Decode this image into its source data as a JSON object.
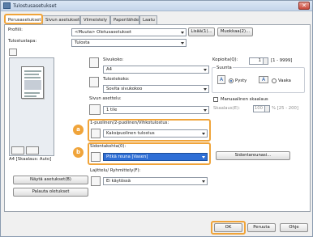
{
  "window": {
    "title": "Tulostusasetukset",
    "close_label": "✕"
  },
  "tabs": [
    "Perusasetukset",
    "Sivun asetukset",
    "Viimeistely",
    "Paperilähde",
    "Laatu"
  ],
  "profile": {
    "label": "Profiili:",
    "value": "<Muuta> Oletusasetukset",
    "add_button": "Lisää(1)...",
    "edit_button": "Muokkaa(2)..."
  },
  "output_method": {
    "label": "Tulostustapa:",
    "value": "Tulosta"
  },
  "preview": {
    "status": "A4 [Skaalaus: Auto]"
  },
  "page_size": {
    "label": "Sivukoko:",
    "value": "A4"
  },
  "output_size": {
    "label": "Tulostekoko:",
    "value": "Sovita sivukokoo"
  },
  "copies": {
    "label": "Kopioita(Q):",
    "value": "1",
    "range": "[1 - 9999]"
  },
  "orientation": {
    "label": "Suunta",
    "portrait": "Pysty",
    "landscape": "Vaaka",
    "portrait_icon": "A",
    "landscape_icon": "A"
  },
  "page_layout": {
    "label": "Sivun asettelu:",
    "value": "1 tile"
  },
  "manual_scaling": {
    "label": "Manuaalinen skaalaus",
    "scale_label": "Skaalaus(E):",
    "scale_value": "100",
    "scale_range": "% [25 - 200]"
  },
  "duplex": {
    "badge": "a",
    "label": "1-puolinen/2-puolinen/Vihkotulostus:",
    "value": "Kaksipuolinen tulostus"
  },
  "binding": {
    "badge": "b",
    "label": "Sidontakohta(0):",
    "value": "Pitkä reuna [Vasen]",
    "button": "Sidontareunasi..."
  },
  "booklet": {
    "label": "Lajittelu/ Ryhmittely(F):",
    "value": "Ei käytössä"
  },
  "left_buttons": {
    "settings": "Näytä asetukset(B)",
    "restore": "Palauta oletukset"
  },
  "footer": {
    "ok": "OK",
    "cancel": "Peruuta",
    "help": "Ohje"
  }
}
